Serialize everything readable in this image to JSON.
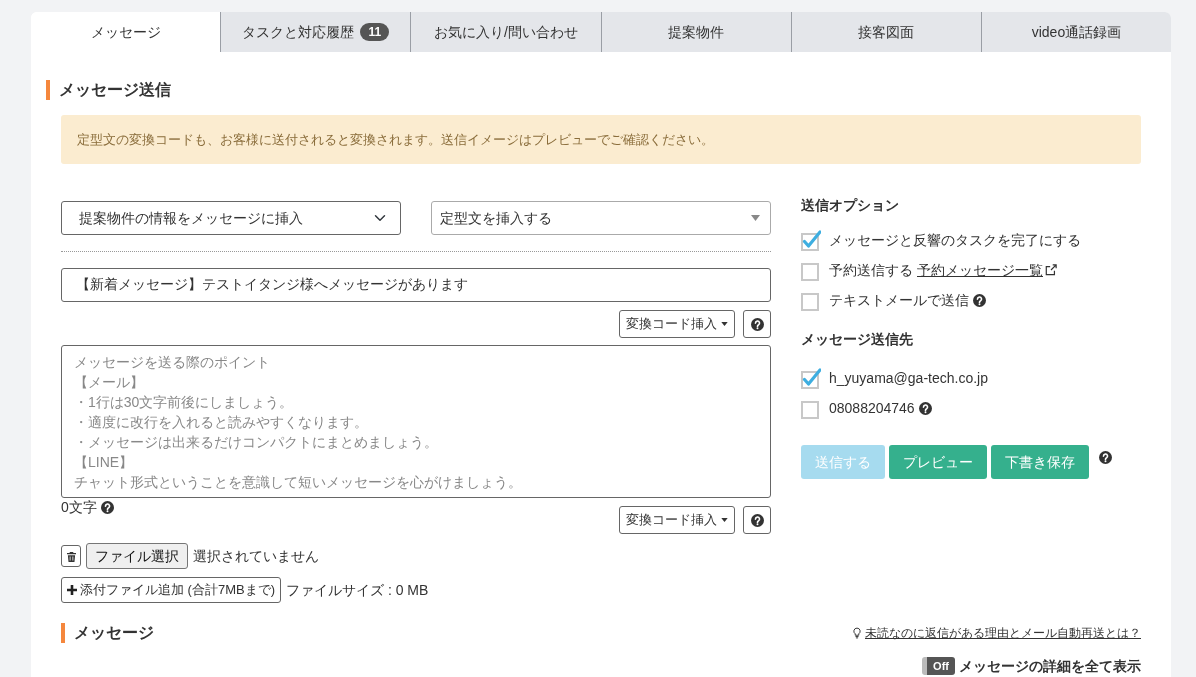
{
  "tabs": [
    {
      "label": "メッセージ",
      "selected": true
    },
    {
      "label": "タスクと対応履歴",
      "badge": "11",
      "selected": false
    },
    {
      "label": "お気に入り/問い合わせ",
      "selected": false
    },
    {
      "label": "提案物件",
      "selected": false
    },
    {
      "label": "接客図面",
      "selected": false
    },
    {
      "label": "video通話録画",
      "selected": false
    }
  ],
  "compose": {
    "title": "メッセージ送信",
    "notice": "定型文の変換コードも、お客様に送付されると変換されます。送信イメージはプレビューでご確認ください。",
    "property_select": {
      "value": "提案物件の情報をメッセージに挿入"
    },
    "template_select": {
      "value": "定型文を挿入する"
    },
    "subject": {
      "value": "【新着メッセージ】テストイタンジ様へメッセージがあります"
    },
    "subject_code_button": "変換コード挿入",
    "body": {
      "placeholder": [
        "メッセージを送る際のポイント",
        "【メール】",
        "・1行は30文字前後にしましょう。",
        "・適度に改行を入れると読みやすくなります。",
        "・メッセージは出来るだけコンパクトにまとめましょう。",
        "【LINE】",
        "チャット形式ということを意識して短いメッセージを心がけましょう。"
      ]
    },
    "char_count": "0文字",
    "body_code_button": "変換コード挿入",
    "file": {
      "choose_button": "ファイル選択",
      "status": "選択されていません"
    },
    "add_file_button": "添付ファイル追加 (合計7MBまで)",
    "file_size": "ファイルサイズ : 0 MB"
  },
  "send_options": {
    "title": "送信オプション",
    "options": [
      {
        "label": "メッセージと反響のタスクを完了にする",
        "checked": true
      },
      {
        "label": "予約送信する",
        "link": "予約メッセージ一覧",
        "checked": false
      },
      {
        "label": "テキストメールで送信",
        "help": true,
        "checked": false
      }
    ]
  },
  "recipients": {
    "title": "メッセージ送信先",
    "items": [
      {
        "label": "h_yuyama@ga-tech.co.jp",
        "checked": true
      },
      {
        "label": "08088204746",
        "help": true,
        "checked": false
      }
    ]
  },
  "actions": [
    {
      "label": "送信する",
      "kind": "send",
      "disabled": true
    },
    {
      "label": "プレビュー",
      "kind": "preview",
      "disabled": false
    },
    {
      "label": "下書き保存",
      "kind": "draft",
      "disabled": false
    }
  ],
  "messages": {
    "title": "メッセージ",
    "help_link": "未読なのに返信がある理由とメール自動再送とは？",
    "detail_toggle": {
      "text": "Off",
      "on": false
    },
    "detail_label": "メッセージの詳細を全て表示"
  }
}
